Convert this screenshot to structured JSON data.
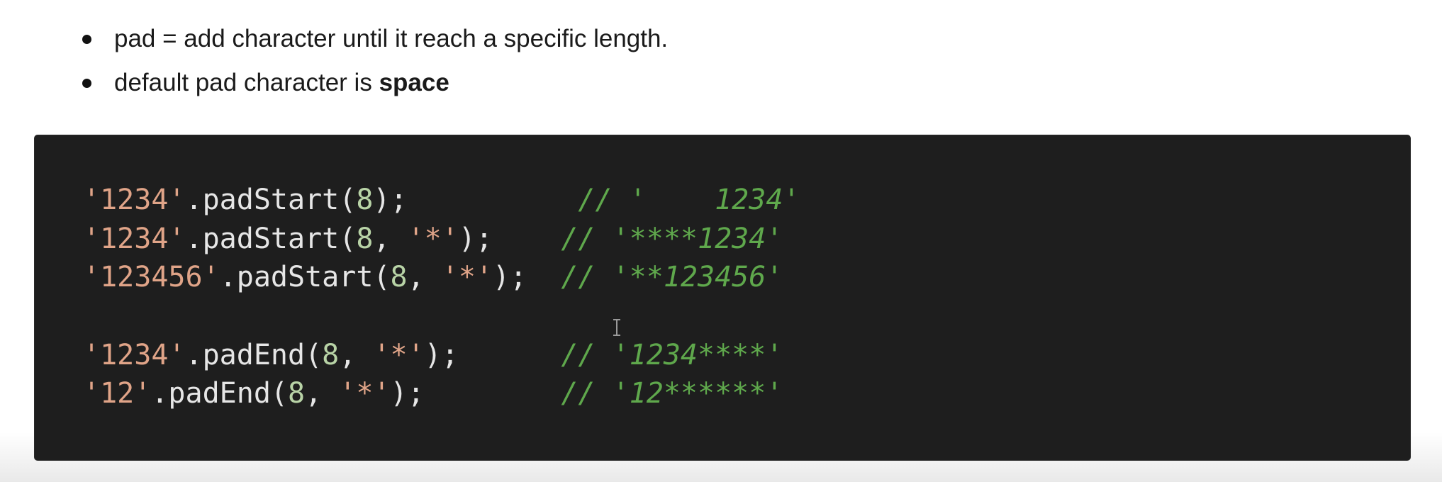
{
  "bullets": [
    {
      "text": "pad = add character until it reach a specific length.",
      "bold": ""
    },
    {
      "text": "default pad character is ",
      "bold": "space"
    }
  ],
  "code": {
    "lines": [
      {
        "str": "'1234'",
        "method": ".padStart(",
        "num": "8",
        "sep": "",
        "arg": "",
        "close": ");",
        "pad": "          ",
        "comment": "// '    1234'"
      },
      {
        "str": "'1234'",
        "method": ".padStart(",
        "num": "8",
        "sep": ", ",
        "arg": "'*'",
        "close": ");",
        "pad": "    ",
        "comment": "// '****1234'"
      },
      {
        "str": "'123456'",
        "method": ".padStart(",
        "num": "8",
        "sep": ", ",
        "arg": "'*'",
        "close": ");",
        "pad": "  ",
        "comment": "// '**123456'"
      },
      {
        "str": "'1234'",
        "method": ".padEnd(",
        "num": "8",
        "sep": ", ",
        "arg": "'*'",
        "close": ");",
        "pad": "      ",
        "comment": "// '1234****'"
      },
      {
        "str": "'12'",
        "method": ".padEnd(",
        "num": "8",
        "sep": ", ",
        "arg": "'*'",
        "close": ");",
        "pad": "        ",
        "comment": "// '12******'"
      }
    ]
  },
  "colors": {
    "code_background": "#1e1e1e",
    "string": "#e0a488",
    "number": "#b8d3a6",
    "comment": "#5fa84c",
    "plain": "#e6e6e6"
  },
  "icons": {
    "cursor": "text-cursor-icon"
  }
}
